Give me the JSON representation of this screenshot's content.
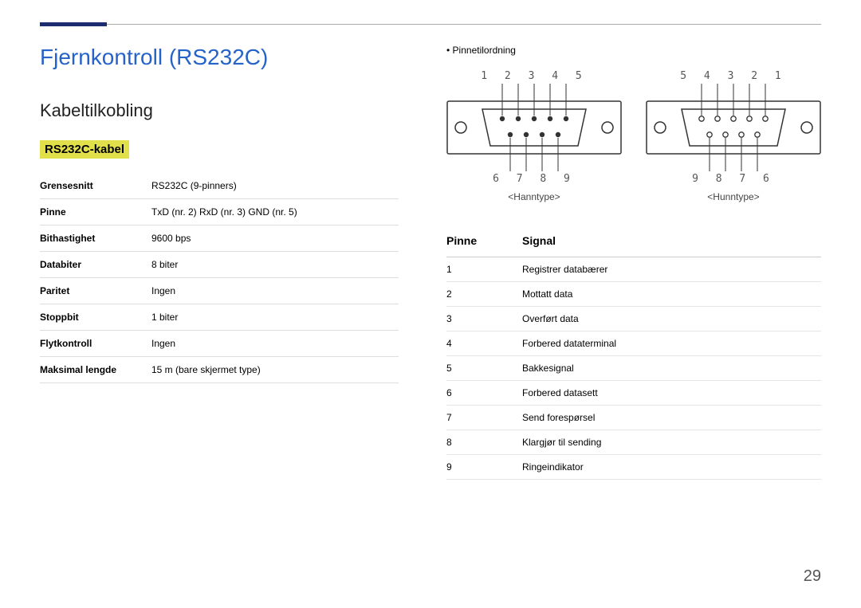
{
  "page_number": "29",
  "main_title": "Fjernkontroll (RS232C)",
  "sub_title": "Kabeltilkobling",
  "section_label": "RS232C-kabel",
  "spec_table": [
    {
      "label": "Grensesnitt",
      "value": "RS232C (9-pinners)"
    },
    {
      "label": "Pinne",
      "value": "TxD (nr. 2) RxD (nr. 3) GND (nr. 5)"
    },
    {
      "label": "Bithastighet",
      "value": "9600 bps"
    },
    {
      "label": "Databiter",
      "value": "8 biter"
    },
    {
      "label": "Paritet",
      "value": "Ingen"
    },
    {
      "label": "Stoppbit",
      "value": "1 biter"
    },
    {
      "label": "Flytkontroll",
      "value": "Ingen"
    },
    {
      "label": "Maksimal lengde",
      "value": "15 m (bare skjermet type)"
    }
  ],
  "bullet_heading": "Pinnetilordning",
  "connectors": {
    "male": {
      "top_numbers": "1 2 3 4 5",
      "bottom_numbers": "6 7 8 9",
      "caption": "<Hanntype>"
    },
    "female": {
      "top_numbers": "5 4 3 2 1",
      "bottom_numbers": "9 8 7 6",
      "caption": "<Hunntype>"
    }
  },
  "pin_table": {
    "headers": {
      "pin": "Pinne",
      "signal": "Signal"
    },
    "rows": [
      {
        "pin": "1",
        "signal": "Registrer databærer"
      },
      {
        "pin": "2",
        "signal": "Mottatt data"
      },
      {
        "pin": "3",
        "signal": "Overført data"
      },
      {
        "pin": "4",
        "signal": "Forbered dataterminal"
      },
      {
        "pin": "5",
        "signal": "Bakkesignal"
      },
      {
        "pin": "6",
        "signal": "Forbered datasett"
      },
      {
        "pin": "7",
        "signal": "Send forespørsel"
      },
      {
        "pin": "8",
        "signal": "Klargjør til sending"
      },
      {
        "pin": "9",
        "signal": "Ringeindikator"
      }
    ]
  }
}
